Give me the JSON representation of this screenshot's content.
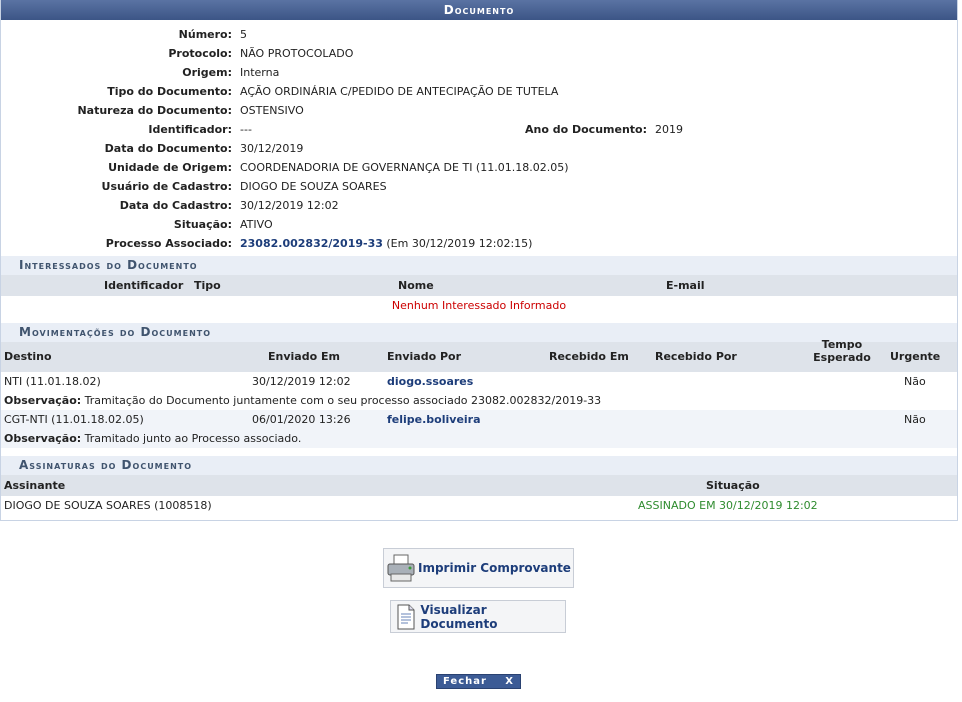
{
  "caption": "Documento",
  "fields": {
    "numero": {
      "label": "Número:",
      "value": "5"
    },
    "protocolo": {
      "label": "Protocolo:",
      "value": "NÃO PROTOCOLADO"
    },
    "origem": {
      "label": "Origem:",
      "value": "Interna"
    },
    "tipo": {
      "label": "Tipo do Documento:",
      "value": "AÇÃO ORDINÁRIA C/PEDIDO DE ANTECIPAÇÃO DE TUTELA"
    },
    "natureza": {
      "label": "Natureza do Documento:",
      "value": "OSTENSIVO"
    },
    "identificador": {
      "label": "Identificador:",
      "value": "---"
    },
    "ano": {
      "label": "Ano do Documento:",
      "value": "2019"
    },
    "data_documento": {
      "label": "Data do Documento:",
      "value": "30/12/2019"
    },
    "unidade": {
      "label": "Unidade de Origem:",
      "value": "COORDENADORIA DE GOVERNANÇA DE TI (11.01.18.02.05)"
    },
    "usuario": {
      "label": "Usuário de Cadastro:",
      "value": "DIOGO DE SOUZA SOARES"
    },
    "data_cadastro": {
      "label": "Data do Cadastro:",
      "value": "30/12/2019 12:02"
    },
    "situacao": {
      "label": "Situação:",
      "value": "ATIVO"
    },
    "processo": {
      "label": "Processo Associado:",
      "link": "23082.002832/2019-33",
      "suffix": "(Em 30/12/2019 12:02:15)"
    }
  },
  "interessados": {
    "title": "Interessados do Documento",
    "headers": {
      "identificador": "Identificador",
      "tipo": "Tipo",
      "nome": "Nome",
      "email": "E-mail"
    },
    "empty": "Nenhum Interessado Informado"
  },
  "movimentacoes": {
    "title": "Movimentações do Documento",
    "headers": {
      "destino": "Destino",
      "enviado_em": "Enviado Em",
      "enviado_por": "Enviado Por",
      "recebido_em": "Recebido Em",
      "recebido_por": "Recebido Por",
      "tempo_l1": "Tempo",
      "tempo_l2": "Esperado",
      "urgente": "Urgente"
    },
    "obs_label": "Observação:",
    "rows": [
      {
        "destino": "NTI (11.01.18.02)",
        "enviado_em": "30/12/2019 12:02",
        "enviado_por": "diogo.ssoares",
        "urgente": "Não",
        "obs": "Tramitação do Documento juntamente com o seu processo associado 23082.002832/2019-33"
      },
      {
        "destino": "CGT-NTI (11.01.18.02.05)",
        "enviado_em": "06/01/2020 13:26",
        "enviado_por": "felipe.boliveira",
        "urgente": "Não",
        "obs": "Tramitado junto ao Processo associado."
      }
    ]
  },
  "assinaturas": {
    "title": "Assinaturas do Documento",
    "headers": {
      "assinante": "Assinante",
      "situacao": "Situação"
    },
    "rows": [
      {
        "assinante": "DIOGO DE SOUZA SOARES (1008518)",
        "situacao": "ASSINADO EM 30/12/2019 12:02"
      }
    ]
  },
  "buttons": {
    "imprimir": "Imprimir Comprovante",
    "visualizar": "Visualizar Documento",
    "fechar": "Fechar",
    "fechar_x": "X"
  }
}
